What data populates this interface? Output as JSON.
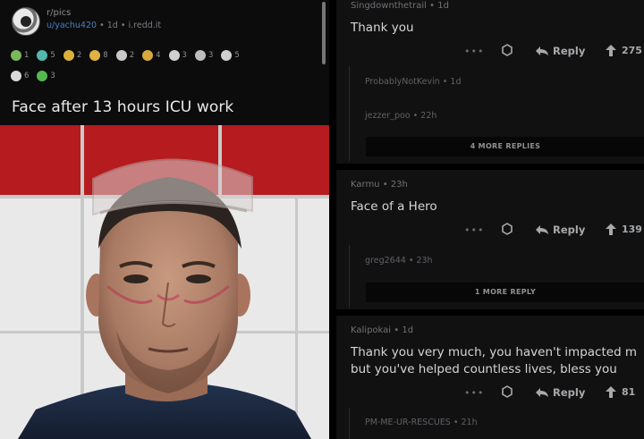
{
  "post": {
    "subreddit": "r/pics",
    "author": "u/yachu420",
    "age": "1d",
    "domain": "i.redd.it",
    "title": "Face after 13 hours ICU work",
    "awards_row1": [
      {
        "icon": "award-icon",
        "count": "1",
        "color": "#7ab85b"
      },
      {
        "icon": "award-icon",
        "count": "5",
        "color": "#54b8b1"
      },
      {
        "icon": "award-icon",
        "count": "2",
        "color": "#d9b23a"
      },
      {
        "icon": "award-icon",
        "count": "8",
        "color": "#e0b341"
      },
      {
        "icon": "award-icon",
        "count": "2",
        "color": "#c9c9c9"
      },
      {
        "icon": "award-icon",
        "count": "4",
        "color": "#d8a93a"
      },
      {
        "icon": "award-icon",
        "count": "3",
        "color": "#d0d0d0"
      },
      {
        "icon": "award-icon",
        "count": "3",
        "color": "#bdbdbd"
      },
      {
        "icon": "award-icon",
        "count": "5",
        "color": "#cfcfcf"
      }
    ],
    "awards_row2": [
      {
        "icon": "award-icon",
        "count": "6",
        "color": "#d9d9d9"
      },
      {
        "icon": "award-icon",
        "count": "3",
        "color": "#55b84f"
      }
    ]
  },
  "comments": [
    {
      "user": "Singdownthetrail",
      "age": "1d",
      "body": [
        "Thank you"
      ],
      "reply_label": "Reply",
      "votes": "275",
      "replies": [
        {
          "user": "ProbablyNotKevin",
          "age": "1d"
        },
        {
          "user": "jezzer_poo",
          "age": "22h"
        }
      ],
      "more": "4 MORE REPLIES"
    },
    {
      "user": "Karmu",
      "age": "23h",
      "body": [
        "Face of a Hero"
      ],
      "reply_label": "Reply",
      "votes": "139",
      "replies": [
        {
          "user": "greg2644",
          "age": "23h"
        }
      ],
      "more": "1 MORE REPLY"
    },
    {
      "user": "Kalipokai",
      "age": "1d",
      "body": [
        "Thank you very much, you haven't impacted m",
        "but you've helped countless lives, bless you"
      ],
      "reply_label": "Reply",
      "votes": "81",
      "replies": [
        {
          "user": "PM-ME-UR-RESCUES",
          "age": "21h"
        }
      ]
    }
  ],
  "ui": {
    "dots": "•••",
    "sep": "•"
  },
  "colors": {
    "link_blue": "#4a7fbf",
    "tile_red": "#b51b1f",
    "panel_bg": "#111112"
  }
}
